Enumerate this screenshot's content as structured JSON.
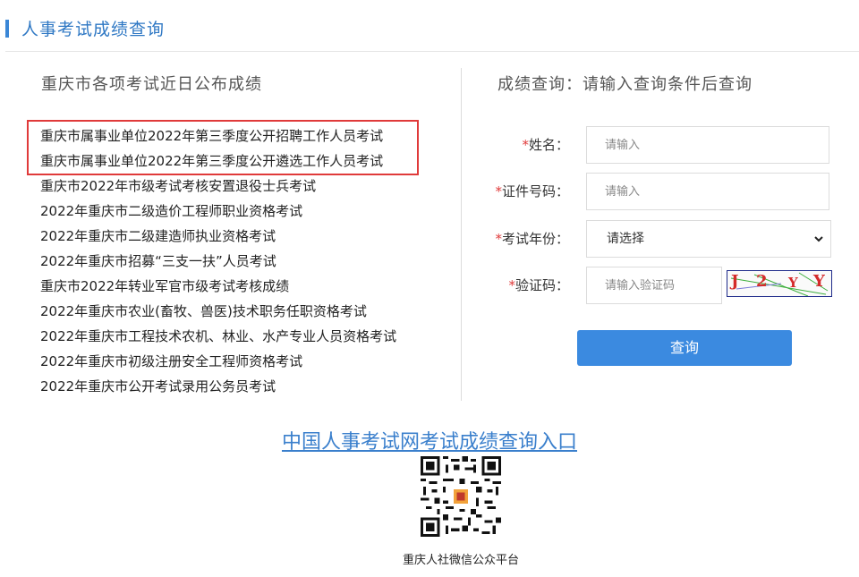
{
  "header": {
    "title": "人事考试成绩查询"
  },
  "left": {
    "title": "重庆市各项考试近日公布成绩",
    "exams": [
      "重庆市属事业单位2022年第三季度公开招聘工作人员考试",
      "重庆市属事业单位2022年第三季度公开遴选工作人员考试",
      "重庆市2022年市级考试考核安置退役士兵考试",
      "2022年重庆市二级造价工程师职业资格考试",
      "2022年重庆市二级建造师执业资格考试",
      "2022年重庆市招募“三支一扶”人员考试",
      "重庆市2022年转业军官市级考试考核成绩",
      "2022年重庆市农业(畜牧、兽医)技术职务任职资格考试",
      "2022年重庆市工程技术农机、林业、水产专业人员资格考试",
      "2022年重庆市初级注册安全工程师资格考试",
      "2022年重庆市公开考试录用公务员考试"
    ],
    "highlight_color": "#e03a3a"
  },
  "right": {
    "title": "成绩查询：请输入查询条件后查询",
    "required_mark": "*",
    "fields": {
      "name": {
        "label": "姓名：",
        "placeholder": "请输入"
      },
      "id": {
        "label": "证件号码：",
        "placeholder": "请输入"
      },
      "year": {
        "label": "考试年份：",
        "selected": "请选择"
      },
      "captcha": {
        "label": "验证码：",
        "placeholder": "请输入验证码"
      }
    },
    "captcha_chars": [
      "J",
      "2",
      "Y",
      "Y"
    ],
    "query_button": "查询"
  },
  "footer": {
    "portal_link": "中国人事考试网考试成绩查询入口",
    "qr_caption": "重庆人社微信公众平台"
  },
  "colors": {
    "accent": "#3a86d6",
    "button": "#3b8ae0",
    "required": "#e03a3a"
  }
}
